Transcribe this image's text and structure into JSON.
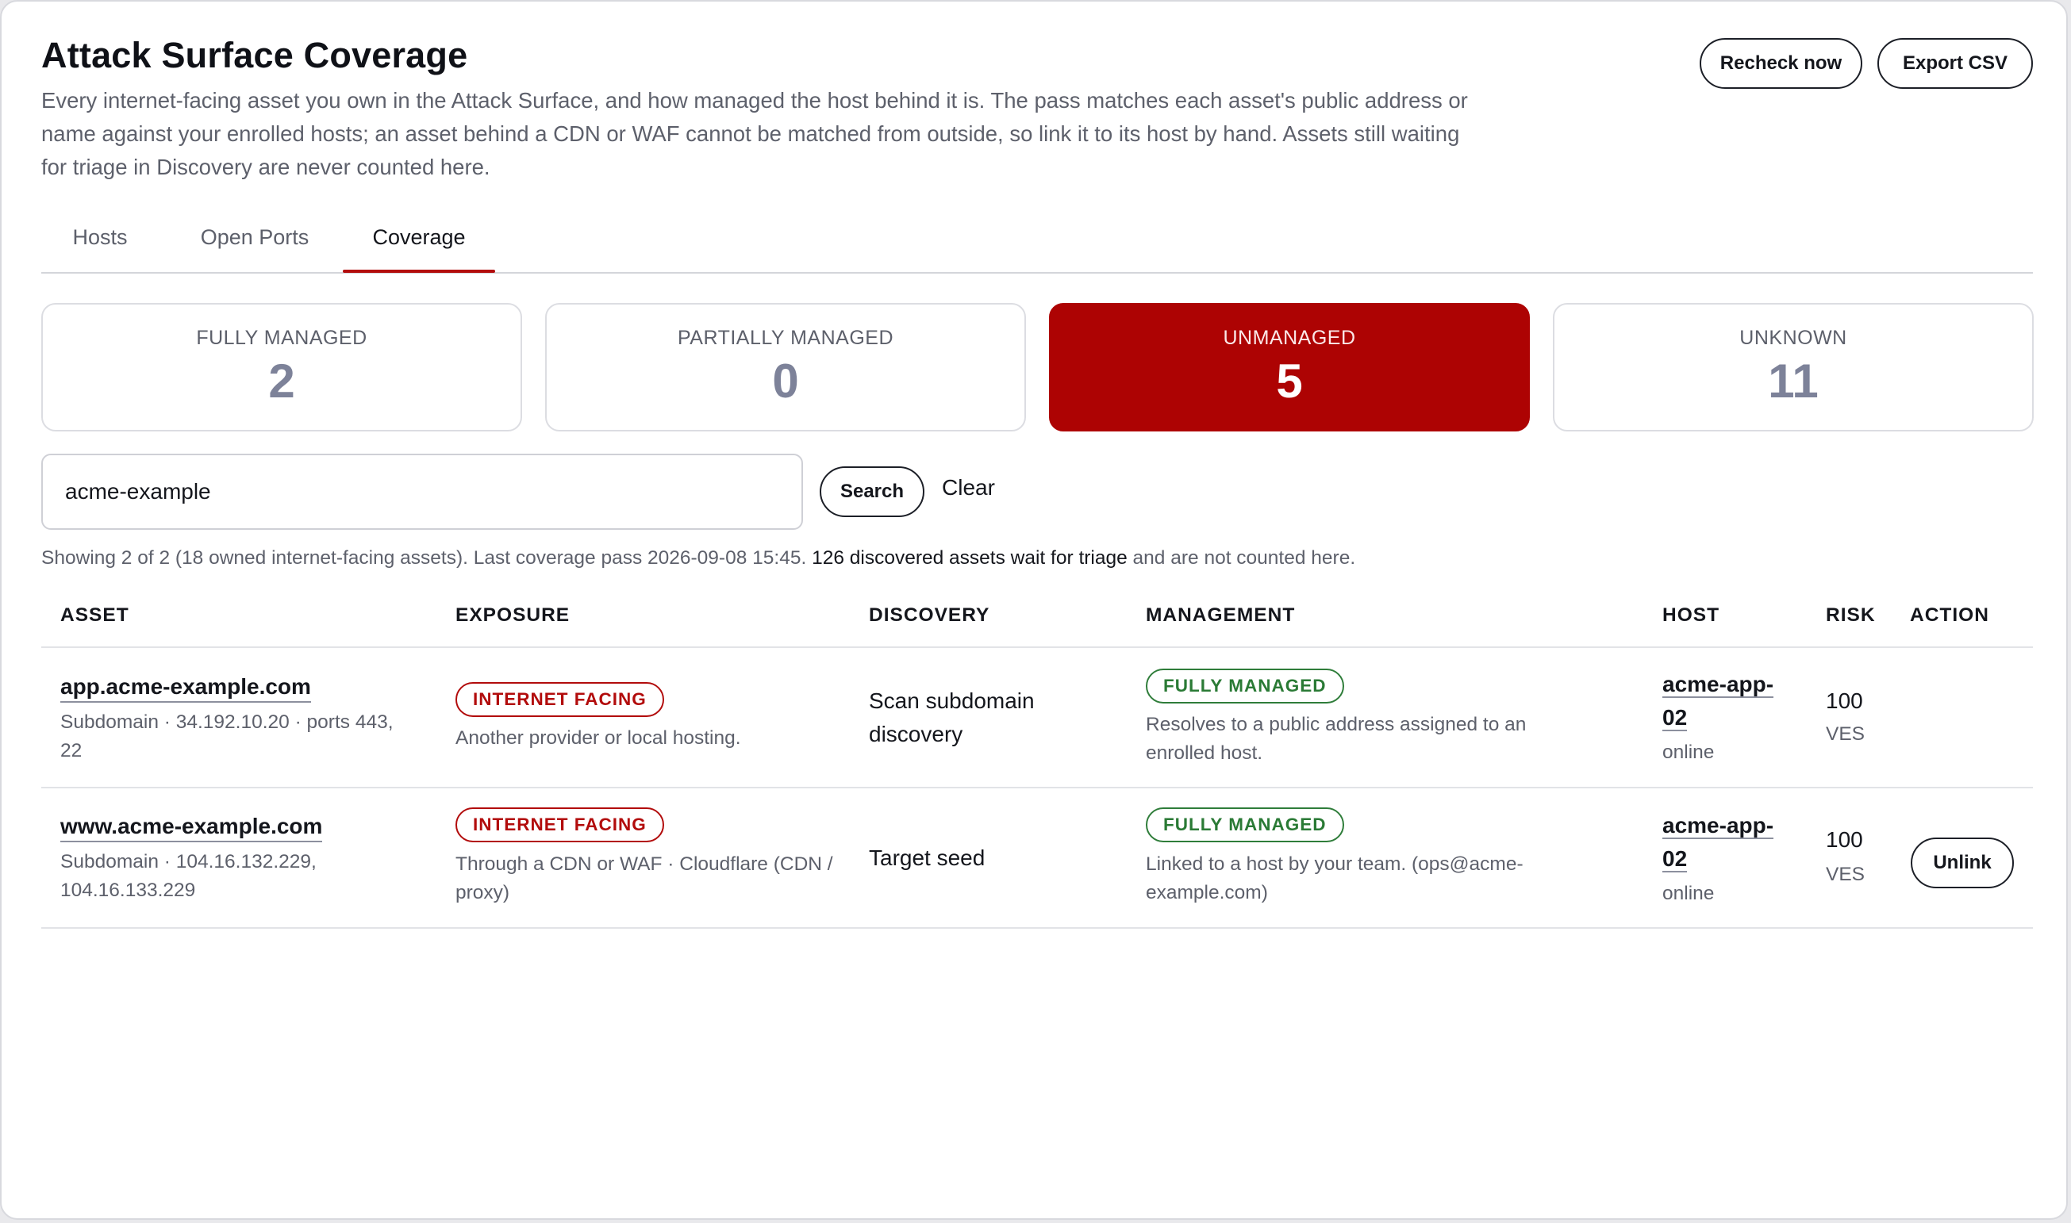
{
  "header": {
    "title": "Attack Surface Coverage",
    "description": "Every internet-facing asset you own in the Attack Surface, and how managed the host behind it is. The pass matches each asset's public address or name against your enrolled hosts; an asset behind a CDN or WAF cannot be matched from outside, so link it to its host by hand. Assets still waiting for triage in Discovery are never counted here.",
    "recheck_label": "Recheck now",
    "export_label": "Export CSV"
  },
  "tabs": [
    {
      "label": "Hosts",
      "active": false
    },
    {
      "label": "Open Ports",
      "active": false
    },
    {
      "label": "Coverage",
      "active": true
    }
  ],
  "stats": [
    {
      "label": "FULLY MANAGED",
      "value": "2",
      "selected": false
    },
    {
      "label": "PARTIALLY MANAGED",
      "value": "0",
      "selected": false
    },
    {
      "label": "UNMANAGED",
      "value": "5",
      "selected": true
    },
    {
      "label": "UNKNOWN",
      "value": "11",
      "selected": false
    }
  ],
  "search": {
    "value": "acme-example",
    "search_label": "Search",
    "clear_label": "Clear"
  },
  "summary": {
    "prefix": "Showing 2 of 2 (18 owned internet-facing assets). Last coverage pass 2026-09-08 15:45. ",
    "link": "126 discovered assets wait for triage",
    "suffix": " and are not counted here."
  },
  "table": {
    "columns": [
      "ASSET",
      "EXPOSURE",
      "DISCOVERY",
      "MANAGEMENT",
      "HOST",
      "RISK",
      "ACTION"
    ],
    "rows": [
      {
        "asset": "app.acme-example.com",
        "asset_meta": "Subdomain · 34.192.10.20 · ports 443, 22",
        "exposure_badge": "INTERNET FACING",
        "exposure_note": "Another provider or local hosting.",
        "discovery": "Scan subdomain discovery",
        "management_badge": "FULLY MANAGED",
        "management_note": "Resolves to a public address assigned to an enrolled host.",
        "host": "acme-app-02",
        "host_status": "online",
        "risk": "100",
        "risk_label": "VES",
        "action": ""
      },
      {
        "asset": "www.acme-example.com",
        "asset_meta": "Subdomain · 104.16.132.229, 104.16.133.229",
        "exposure_badge": "INTERNET FACING",
        "exposure_note": "Through a CDN or WAF · Cloudflare (CDN / proxy)",
        "discovery": "Target seed",
        "management_badge": "FULLY MANAGED",
        "management_note": "Linked to a host by your team. (ops@acme-example.com)",
        "host": "acme-app-02",
        "host_status": "online",
        "risk": "100",
        "risk_label": "VES",
        "action": "Unlink"
      }
    ]
  },
  "colors": {
    "accent": "#b20c0c",
    "unmanaged_bg": "#ad0303",
    "managed_green": "#2a7a35",
    "muted_text": "#5d606b",
    "stat_number": "#7d8299"
  }
}
